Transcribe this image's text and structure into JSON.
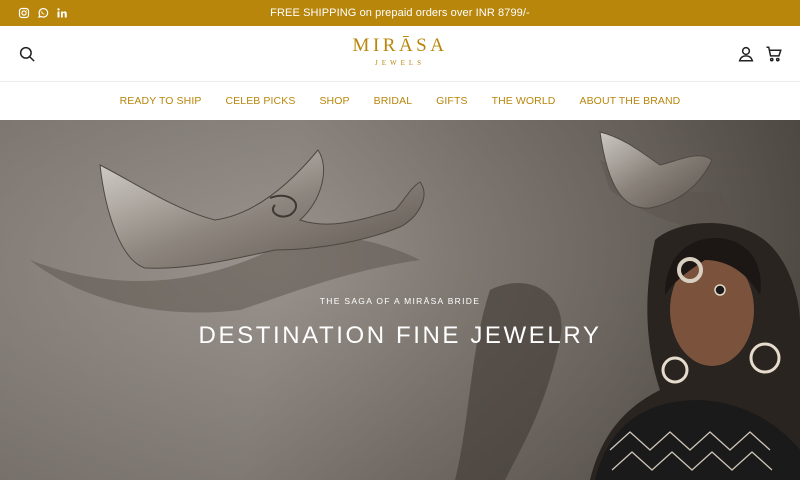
{
  "announcement": {
    "message": "FREE SHIPPING on prepaid orders over INR 8799/-",
    "social": [
      "instagram-icon",
      "whatsapp-icon",
      "linkedin-icon"
    ]
  },
  "header": {
    "brand": "MIRĀSA",
    "brand_sub": "JEWELS",
    "icons": [
      "search-icon",
      "account-icon",
      "cart-icon"
    ]
  },
  "nav": {
    "items": [
      "READY TO SHIP",
      "CELEB PICKS",
      "SHOP",
      "BRIDAL",
      "GIFTS",
      "THE WORLD",
      "ABOUT THE BRAND"
    ]
  },
  "hero": {
    "kicker": "THE SAGA OF A MIRĀSA BRIDE",
    "headline": "DESTINATION FINE JEWELRY"
  },
  "colors": {
    "accent": "#b8860b",
    "announcement_bg": "#b8860b",
    "hero_text": "#ffffff"
  }
}
